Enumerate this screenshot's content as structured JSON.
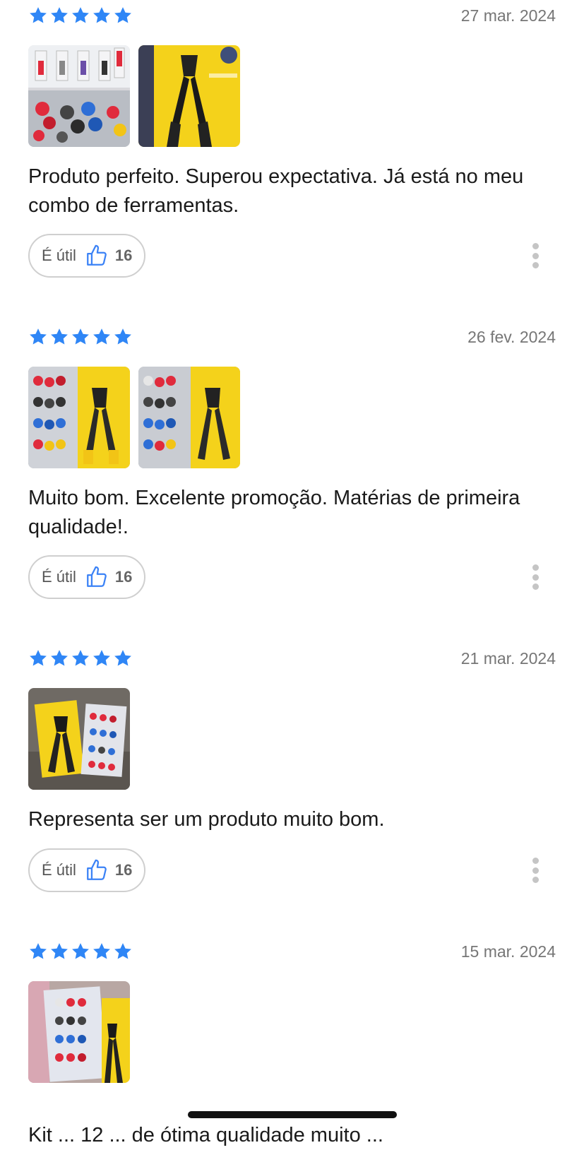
{
  "colors": {
    "star": "#2F86F6",
    "thumb_icon": "#3B82F6",
    "date": "#767676"
  },
  "icons": {
    "rating": "star-icon",
    "helpful": "thumbs-up-icon",
    "menu": "more-vertical-icon"
  },
  "reviews": [
    {
      "rating": 5,
      "date": "27 mar. 2024",
      "text": "Produto perfeito. Superou expectativa. Já está no meu combo de ferramentas.",
      "helpful_label": "É útil",
      "helpful_count": "16",
      "photos": 2
    },
    {
      "rating": 5,
      "date": "26 fev. 2024",
      "text": "Muito bom. Excelente promoção. Matérias de primeira qualidade!.",
      "helpful_label": "É útil",
      "helpful_count": "16",
      "photos": 2
    },
    {
      "rating": 5,
      "date": "21 mar. 2024",
      "text": "Representa ser um produto muito bom.",
      "helpful_label": "É útil",
      "helpful_count": "16",
      "photos": 1
    },
    {
      "rating": 5,
      "date": "15 mar. 2024",
      "photos": 1,
      "partial_text": "Kit ... 12 ... de ótima qualidade muito ..."
    }
  ]
}
